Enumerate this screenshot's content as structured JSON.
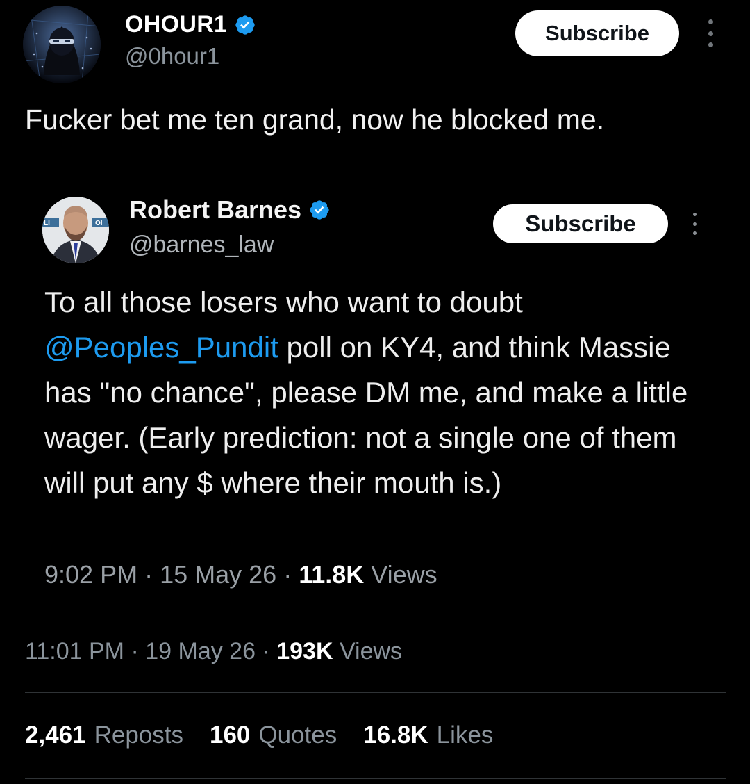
{
  "main_tweet": {
    "author": {
      "display_name": "OHOUR1",
      "handle": "@0hour1",
      "verified": true,
      "avatar_icon": "masked-hacker-avatar"
    },
    "subscribe_label": "Subscribe",
    "more_icon": "vertical-ellipsis-icon",
    "text": "Fucker bet me ten grand, now he blocked me.",
    "time": "11:01 PM",
    "date": "19 May 26",
    "views_count": "193K",
    "views_label": "Views",
    "stats": {
      "reposts_count": "2,461",
      "reposts_label": "Reposts",
      "quotes_count": "160",
      "quotes_label": "Quotes",
      "likes_count": "16.8K",
      "likes_label": "Likes"
    }
  },
  "quoted_tweet": {
    "author": {
      "display_name": "Robert Barnes",
      "handle": "@barnes_law",
      "verified": true,
      "avatar_icon": "man-in-suit-avatar"
    },
    "subscribe_label": "Subscribe",
    "more_icon": "vertical-ellipsis-icon",
    "text_before_mention": "To all those losers who want to doubt ",
    "mention": "@Peoples_Pundit",
    "text_after_mention": " poll on KY4, and think Massie has \"no chance\", please DM me, and make a little wager. (Early prediction: not a single one of them will put any $ where their mouth is.)",
    "time": "9:02 PM",
    "date": "15 May 26",
    "views_count": "11.8K",
    "views_label": "Views"
  },
  "colors": {
    "background": "#000000",
    "text_primary": "#e7e9ea",
    "text_secondary": "#71767b",
    "link": "#1d9bf0",
    "verified_badge": "#1d9bf0",
    "divider": "#2f3336"
  }
}
